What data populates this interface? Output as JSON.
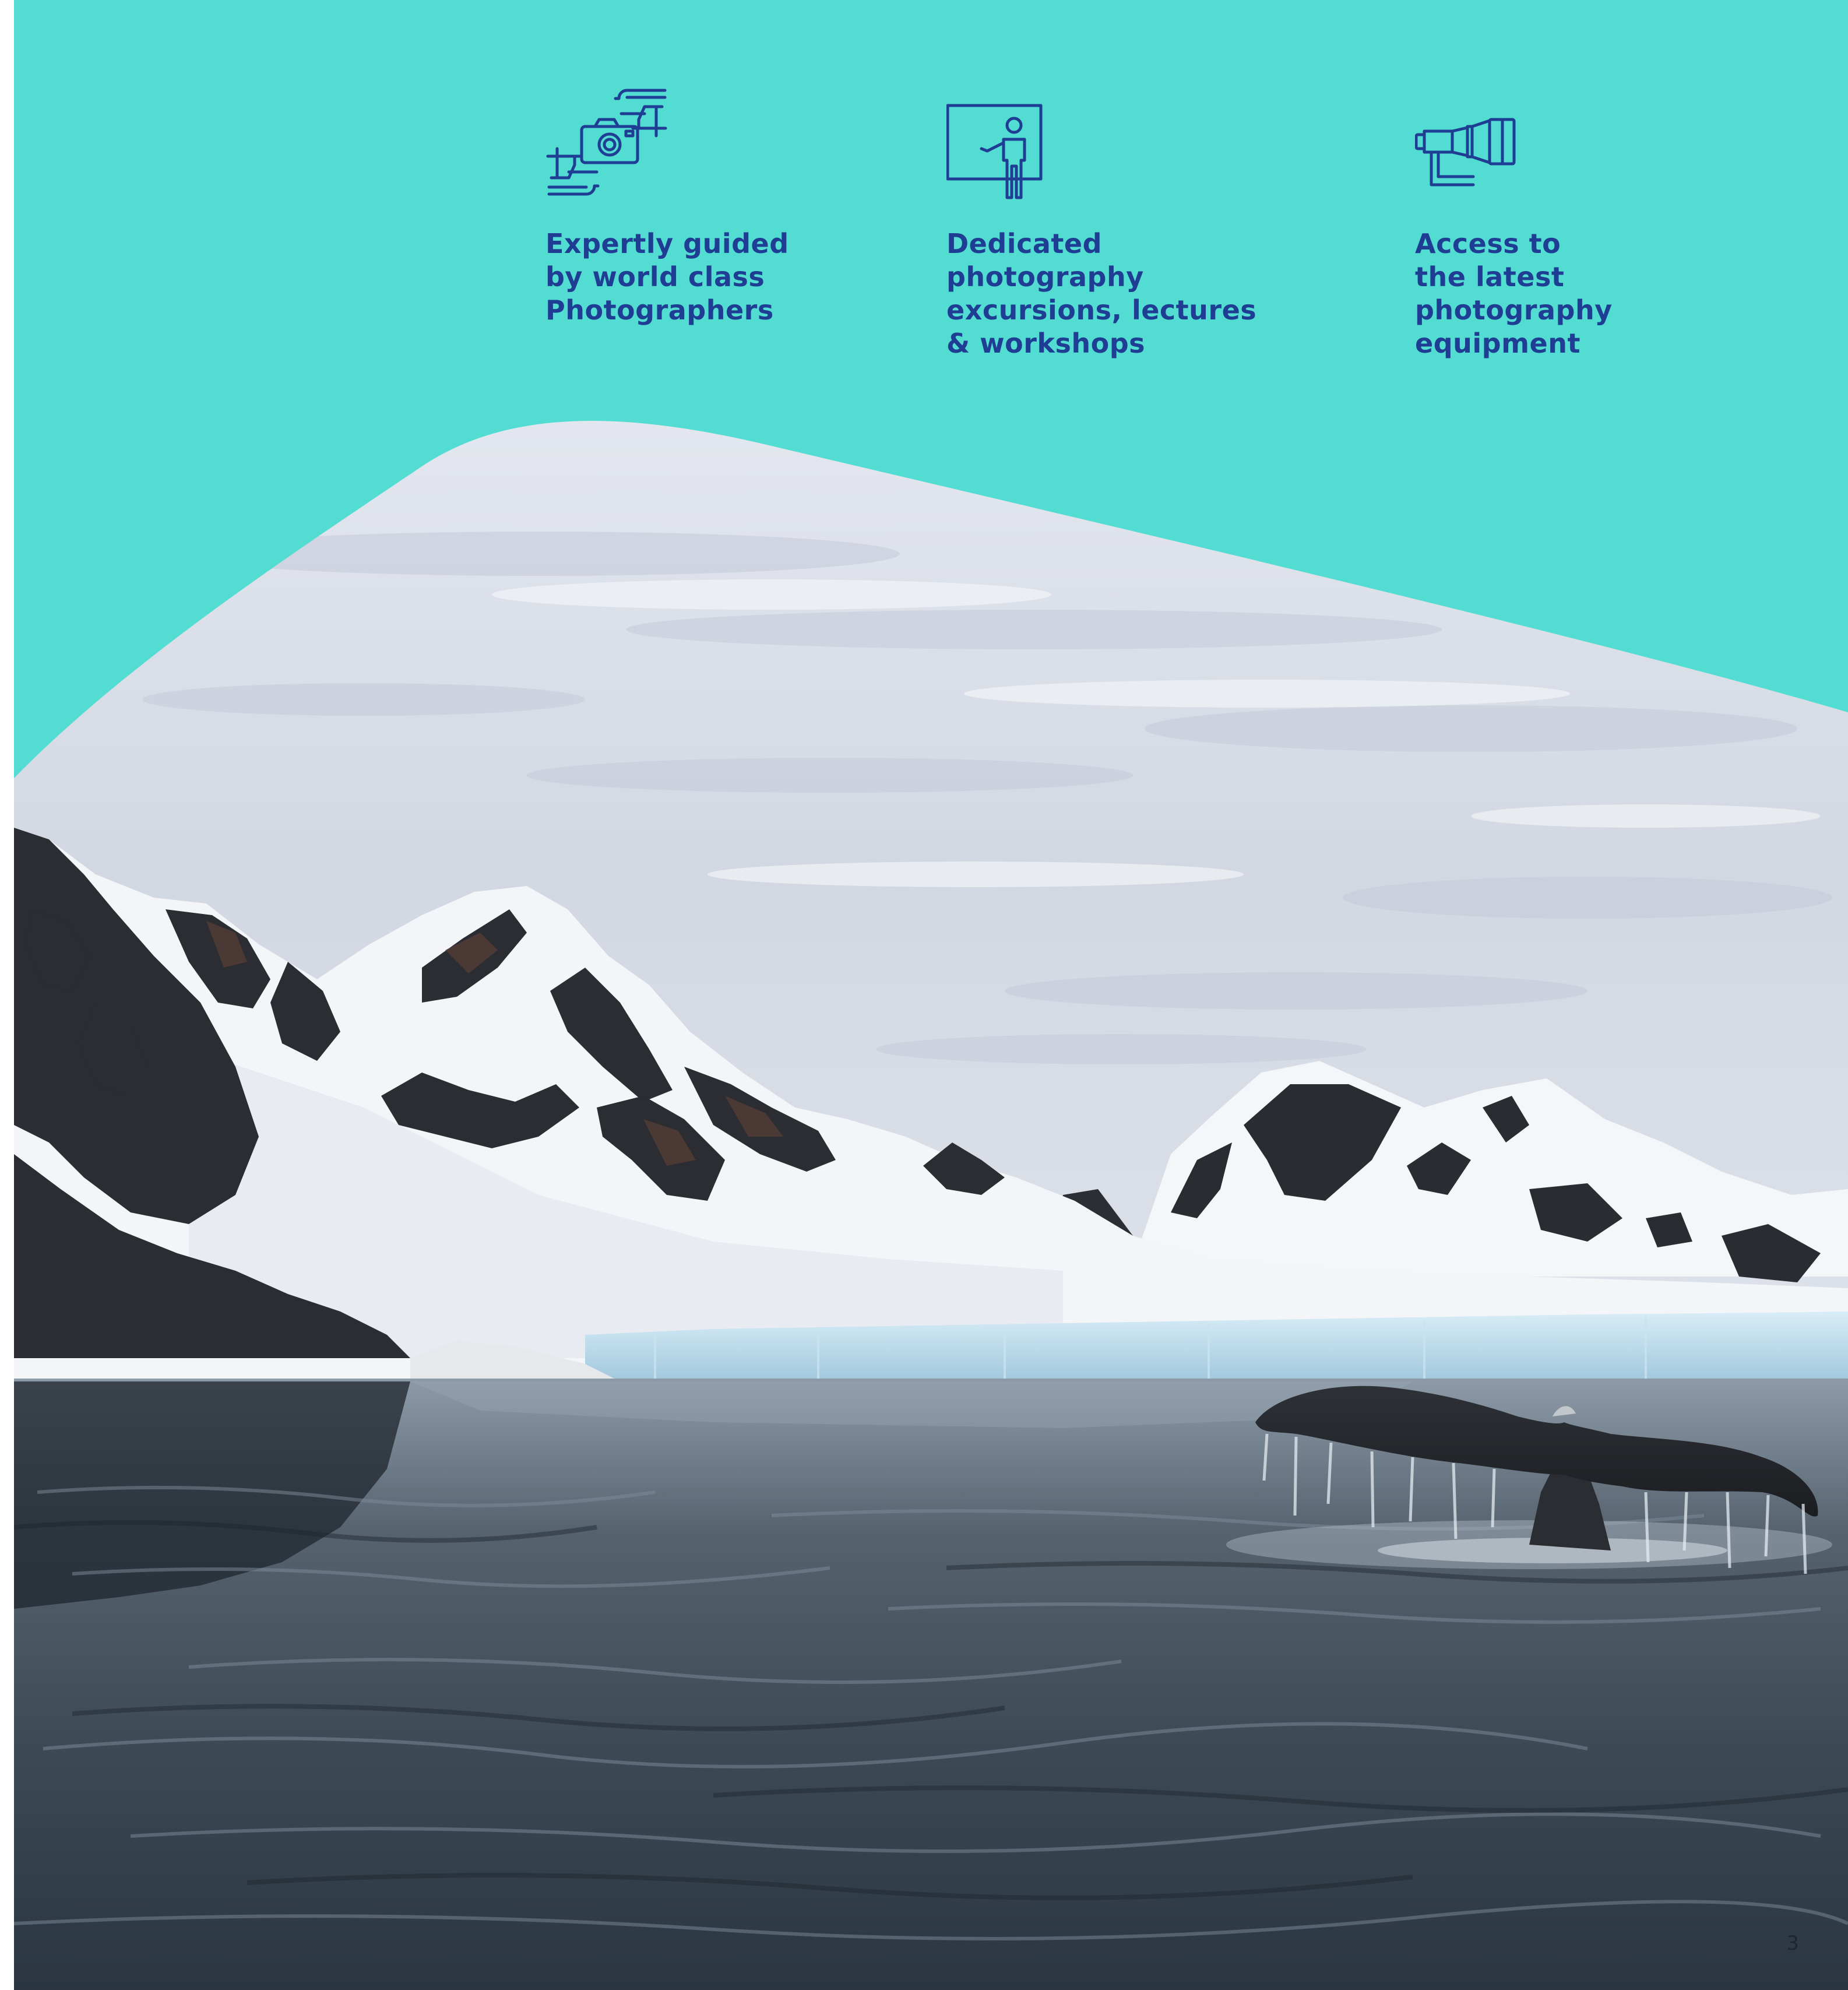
{
  "brand": {
    "background_color": "#52dcd2",
    "text_color": "#1f3e93"
  },
  "features": [
    {
      "icon": "camera-framing-hands-icon",
      "label": "Expertly guided\nby world class\nPhotographers"
    },
    {
      "icon": "presenter-lecture-board-icon",
      "label": "Dedicated\nphotography\nexcursions, lectures\n& workshops"
    },
    {
      "icon": "telephoto-lens-icon",
      "label": "Access to\nthe latest\nphotography\nequipment"
    }
  ],
  "photo": {
    "subject": "whale-tail-antarctic-mountains-photo"
  },
  "page_number": "3"
}
